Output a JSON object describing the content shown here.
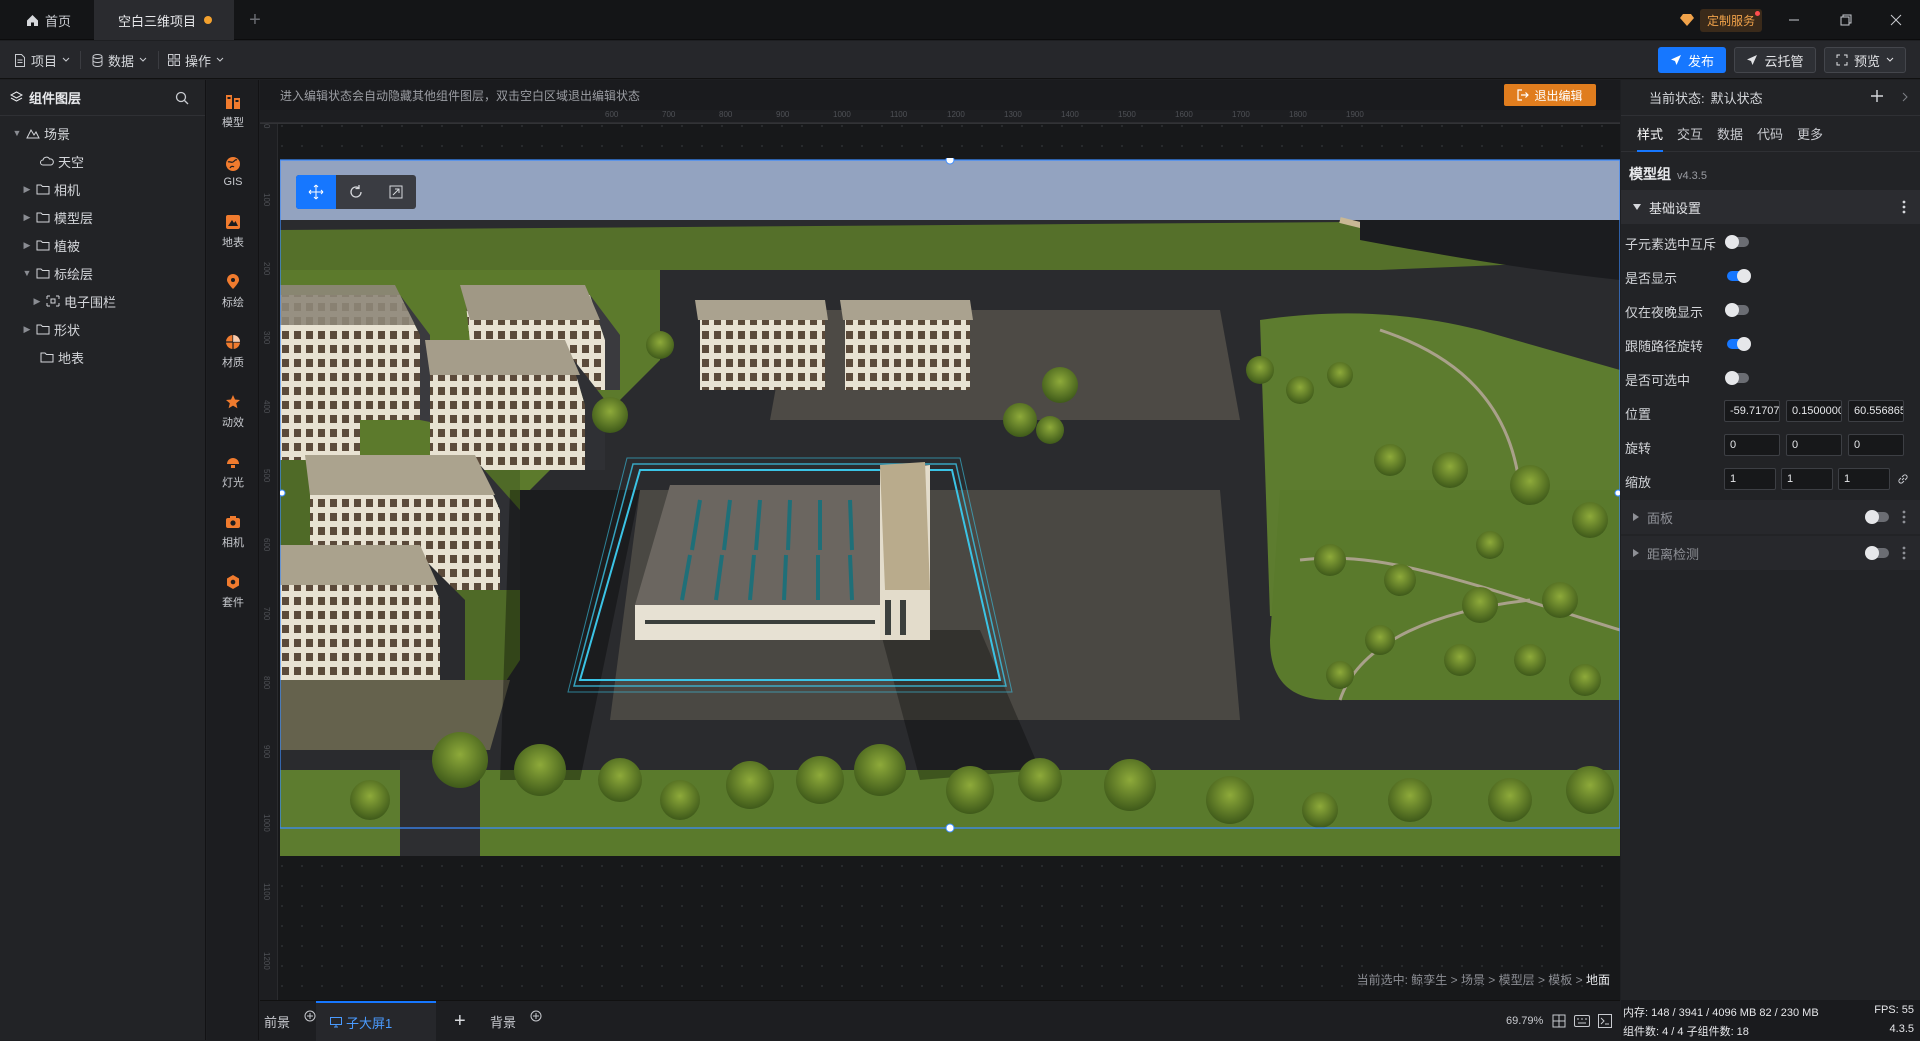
{
  "titlebar": {
    "home_tab": "首页",
    "project_tab": "空白三维项目",
    "custom_service": "定制服务"
  },
  "menubar": {
    "project": "项目",
    "data": "数据",
    "operate": "操作",
    "publish": "发布",
    "cloud": "云托管",
    "preview": "预览"
  },
  "layers": {
    "title": "组件图层",
    "items": [
      "场景",
      "天空",
      "相机",
      "模型层",
      "植被",
      "标绘层",
      "电子围栏",
      "形状",
      "地表"
    ]
  },
  "tools": [
    "模型",
    "GIS",
    "地表",
    "标绘",
    "材质",
    "动效",
    "灯光",
    "相机",
    "套件"
  ],
  "canvas": {
    "hint": "进入编辑状态会自动隐藏其他组件图层，双击空白区域退出编辑状态",
    "exit_edit": "退出编辑",
    "ruler_top": [
      "600",
      "700",
      "800",
      "900",
      "1000",
      "1100",
      "1200",
      "1300",
      "1400",
      "1500",
      "1600",
      "1700",
      "1800",
      "1900"
    ],
    "ruler_left": [
      "0",
      "100",
      "200",
      "300",
      "400",
      "500",
      "600",
      "700",
      "800",
      "900",
      "1000",
      "1100",
      "1200"
    ],
    "breadcrumb_prefix": "当前选中:",
    "breadcrumb_path": "鲸孪生 > 场景 > 模型层 > 模板 >",
    "breadcrumb_current": "地面"
  },
  "bottombar": {
    "foreground": "前景",
    "sub_screen": "子大屏1",
    "background": "背景",
    "zoom": "69.79%"
  },
  "rightpanel": {
    "state_label": "当前状态:",
    "state_value": "默认状态",
    "tabs": [
      "样式",
      "交互",
      "数据",
      "代码",
      "更多"
    ],
    "model_name": "模型组",
    "version": "v4.3.5",
    "section_basic": "基础设置",
    "props": [
      {
        "label": "子元素选中互斥",
        "on": false
      },
      {
        "label": "是否显示",
        "on": true
      },
      {
        "label": "仅在夜晚显示",
        "on": false
      },
      {
        "label": "跟随路径旋转",
        "on": true
      },
      {
        "label": "是否可选中",
        "on": false
      }
    ],
    "position_label": "位置",
    "position": [
      "-59.717079",
      "0.1500000",
      "60.556865"
    ],
    "rotation_label": "旋转",
    "rotation": [
      "0",
      "0",
      "0"
    ],
    "scale_label": "缩放",
    "scale": [
      "1",
      "1",
      "1"
    ],
    "section_panel": "面板",
    "section_distance": "距离检测"
  },
  "status": {
    "memory": "内存: 148 / 3941 / 4096 MB  82 / 230 MB",
    "fps": "FPS: 55",
    "components": "组件数: 4 / 4  子组件数: 18",
    "version": "4.3.5"
  }
}
